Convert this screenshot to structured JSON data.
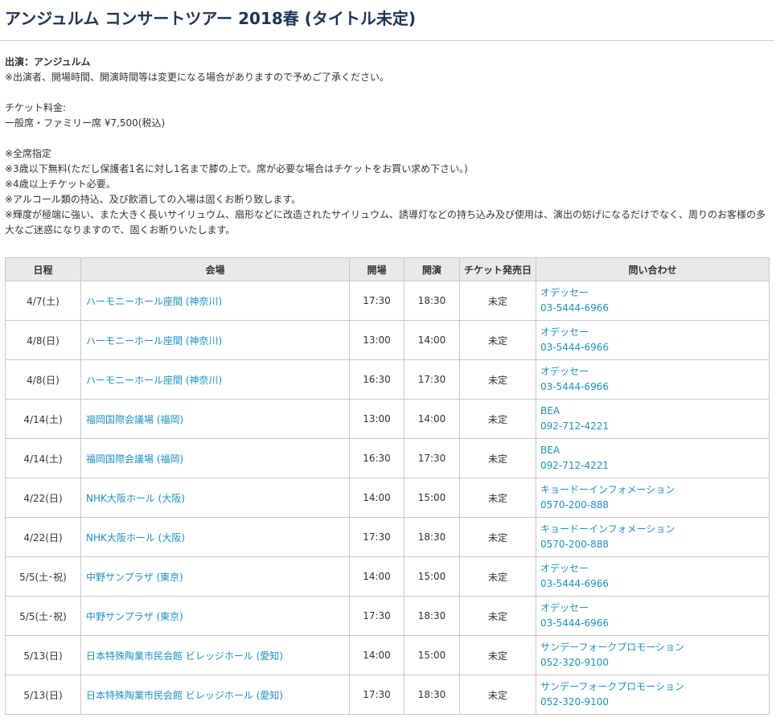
{
  "page": {
    "title": "アンジュルム コンサートツアー 2018春 (タイトル未定)"
  },
  "info": {
    "performer": "出演：アンジュルム",
    "notice": "※出演者、開場時間、開演時間等は変更になる場合がありますので予めご了承ください。",
    "ticket_heading": "チケット料金:",
    "ticket_price": "一般席・ファミリー席 ¥7,500(税込)",
    "notes": [
      "※全席指定",
      "※3歳以下無料(ただし保護者1名に対し1名まで膝の上で。席が必要な場合はチケットをお買い求め下さい。)",
      "※4歳以上チケット必要。",
      "※アルコール類の持込、及び飲酒しての入場は固くお断り致します。",
      "※輝度が極端に強い、また大きく長いサイリュウム、扇形などに改造されたサイリュウム、誘導灯などの持ち込み及び使用は、演出の妨げになるだけでなく、周りのお客様の多大なご迷惑になりますので、固くお断りいたします。"
    ]
  },
  "table": {
    "headers": {
      "date": "日程",
      "venue": "会場",
      "open": "開場",
      "start": "開演",
      "ticket_release": "チケット発売日",
      "contact": "問い合わせ"
    },
    "rows": [
      {
        "date": "4/7(土)",
        "venue": "ハーモニーホール座間 (神奈川)",
        "open": "17:30",
        "start": "18:30",
        "release": "未定",
        "contact_name": "オデッセー",
        "contact_phone": "03-5444-6966"
      },
      {
        "date": "4/8(日)",
        "venue": "ハーモニーホール座間 (神奈川)",
        "open": "13:00",
        "start": "14:00",
        "release": "未定",
        "contact_name": "オデッセー",
        "contact_phone": "03-5444-6966"
      },
      {
        "date": "4/8(日)",
        "venue": "ハーモニーホール座間 (神奈川)",
        "open": "16:30",
        "start": "17:30",
        "release": "未定",
        "contact_name": "オデッセー",
        "contact_phone": "03-5444-6966"
      },
      {
        "date": "4/14(土)",
        "venue": "福岡国際会議場 (福岡)",
        "open": "13:00",
        "start": "14:00",
        "release": "未定",
        "contact_name": "BEA",
        "contact_phone": "092-712-4221"
      },
      {
        "date": "4/14(土)",
        "venue": "福岡国際会議場 (福岡)",
        "open": "16:30",
        "start": "17:30",
        "release": "未定",
        "contact_name": "BEA",
        "contact_phone": "092-712-4221"
      },
      {
        "date": "4/22(日)",
        "venue": "NHK大阪ホール (大阪)",
        "open": "14:00",
        "start": "15:00",
        "release": "未定",
        "contact_name": "キョードーインフォメーション",
        "contact_phone": "0570-200-888"
      },
      {
        "date": "4/22(日)",
        "venue": "NHK大阪ホール (大阪)",
        "open": "17:30",
        "start": "18:30",
        "release": "未定",
        "contact_name": "キョードーインフォメーション",
        "contact_phone": "0570-200-888"
      },
      {
        "date": "5/5(土･祝)",
        "venue": "中野サンプラザ (東京)",
        "open": "14:00",
        "start": "15:00",
        "release": "未定",
        "contact_name": "オデッセー",
        "contact_phone": "03-5444-6966"
      },
      {
        "date": "5/5(土･祝)",
        "venue": "中野サンプラザ (東京)",
        "open": "17:30",
        "start": "18:30",
        "release": "未定",
        "contact_name": "オデッセー",
        "contact_phone": "03-5444-6966"
      },
      {
        "date": "5/13(日)",
        "venue": "日本特殊陶業市民会館 ビレッジホール (愛知)",
        "open": "14:00",
        "start": "15:00",
        "release": "未定",
        "contact_name": "サンデーフォークプロモーション",
        "contact_phone": "052-320-9100"
      },
      {
        "date": "5/13(日)",
        "venue": "日本特殊陶業市民会館 ビレッジホール (愛知)",
        "open": "17:30",
        "start": "18:30",
        "release": "未定",
        "contact_name": "サンデーフォークプロモーション",
        "contact_phone": "052-320-9100"
      }
    ]
  },
  "colors": {
    "title": "#1a3556",
    "link": "#1a91c4",
    "header_bg": "#e9e9e9",
    "border": "#c8c8c8"
  }
}
